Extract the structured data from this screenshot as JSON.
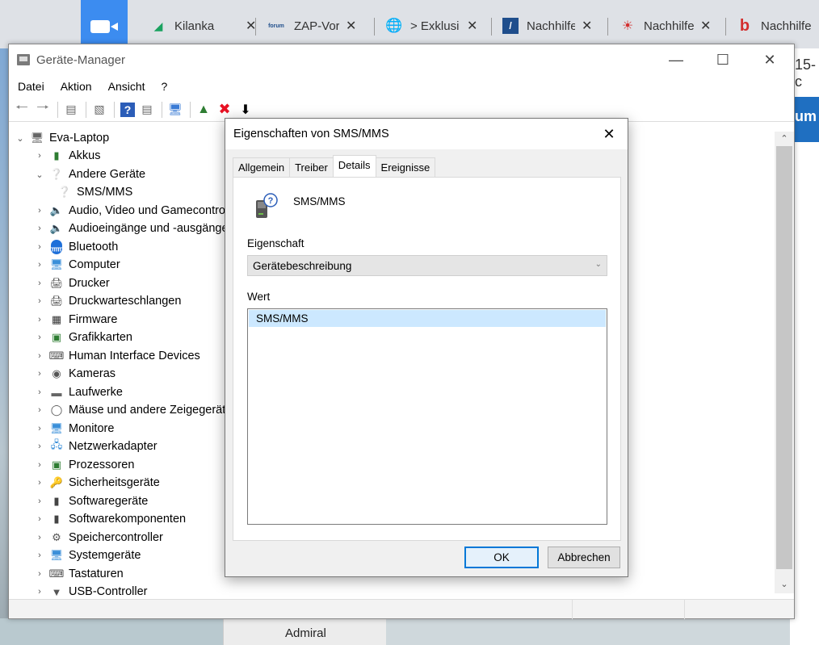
{
  "browser": {
    "tabs": [
      {
        "title": "Kilanka",
        "icon_label": "",
        "icon_color": "#1aa260"
      },
      {
        "title": "ZAP-Vorb",
        "icon_label": "forum",
        "icon_color": "#1f4e8c"
      },
      {
        "title": "> Exklusi",
        "icon_label": "",
        "icon_color": "#555555"
      },
      {
        "title": "Nachhilfe",
        "icon_label": "",
        "icon_color": "#1f4e8c"
      },
      {
        "title": "Nachhilfe",
        "icon_label": "",
        "icon_color": "#d32f2f"
      },
      {
        "title": "Nachhilfe",
        "icon_label": "b",
        "icon_color": "#d32f2f"
      }
    ],
    "page_partial_text": "15-c",
    "page_button_text": "um",
    "bottom_strip_text": "Admiral"
  },
  "device_manager": {
    "title": "Geräte-Manager",
    "menu": [
      "Datei",
      "Aktion",
      "Ansicht",
      "?"
    ],
    "tree": {
      "root": "Eva-Laptop",
      "items": [
        {
          "label": "Akkus",
          "icon": "battery-icon",
          "expanded": false
        },
        {
          "label": "Andere Geräte",
          "icon": "unknown-device-icon",
          "expanded": true
        },
        {
          "label": "SMS/MMS",
          "icon": "unknown-device-icon",
          "child": true
        },
        {
          "label": "Audio, Video und Gamecontroller",
          "icon": "speaker-icon"
        },
        {
          "label": "Audioeingänge und -ausgänge",
          "icon": "speaker-icon"
        },
        {
          "label": "Bluetooth",
          "icon": "bluetooth-icon"
        },
        {
          "label": "Computer",
          "icon": "monitor-icon"
        },
        {
          "label": "Drucker",
          "icon": "printer-icon"
        },
        {
          "label": "Druckwarteschlangen",
          "icon": "printer-icon"
        },
        {
          "label": "Firmware",
          "icon": "chip-icon"
        },
        {
          "label": "Grafikkarten",
          "icon": "display-adapter-icon"
        },
        {
          "label": "Human Interface Devices",
          "icon": "keyboard-icon"
        },
        {
          "label": "Kameras",
          "icon": "camera-icon"
        },
        {
          "label": "Laufwerke",
          "icon": "drive-icon"
        },
        {
          "label": "Mäuse und andere Zeigegeräte",
          "icon": "mouse-icon"
        },
        {
          "label": "Monitore",
          "icon": "monitor-icon"
        },
        {
          "label": "Netzwerkadapter",
          "icon": "network-icon"
        },
        {
          "label": "Prozessoren",
          "icon": "processor-icon"
        },
        {
          "label": "Sicherheitsgeräte",
          "icon": "security-icon"
        },
        {
          "label": "Softwaregeräte",
          "icon": "software-device-icon"
        },
        {
          "label": "Softwarekomponenten",
          "icon": "software-component-icon"
        },
        {
          "label": "Speichercontroller",
          "icon": "storage-controller-icon"
        },
        {
          "label": "Systemgeräte",
          "icon": "system-device-icon"
        },
        {
          "label": "Tastaturen",
          "icon": "keyboard-icon"
        },
        {
          "label": "USB-Controller",
          "icon": "usb-icon"
        }
      ]
    }
  },
  "dialog": {
    "title": "Eigenschaften von SMS/MMS",
    "tabs": [
      "Allgemein",
      "Treiber",
      "Details",
      "Ereignisse"
    ],
    "active_tab": "Details",
    "device_name": "SMS/MMS",
    "property_label": "Eigenschaft",
    "property_value": "Gerätebeschreibung",
    "value_label": "Wert",
    "values": [
      "SMS/MMS"
    ],
    "ok_label": "OK",
    "cancel_label": "Abbrechen"
  },
  "colors": {
    "accent": "#0078d7",
    "selection": "#cce8ff",
    "delete_red": "#e81123"
  }
}
